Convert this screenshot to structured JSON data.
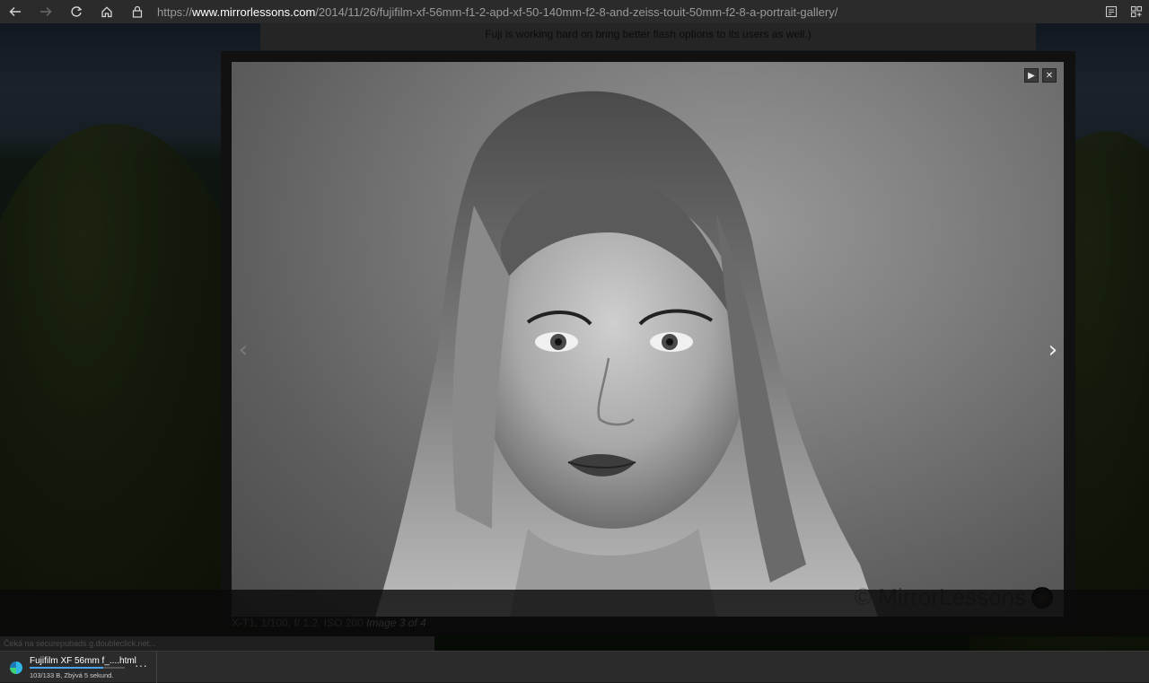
{
  "browser": {
    "url_prefix": "https://",
    "url_host": "www.mirrorlessons.com",
    "url_path": "/2014/11/26/fujifilm-xf-56mm-f1-2-apd-xf-50-140mm-f2-8-and-zeiss-touit-50mm-f2-8-a-portrait-gallery/",
    "icons": [
      "back-icon",
      "forward-icon",
      "refresh-icon",
      "home-icon",
      "lock-icon",
      "reading-view-icon",
      "collections-icon"
    ]
  },
  "page": {
    "text_snippet": "Fuji is working hard on bring better flash options to its users as well.)"
  },
  "lightbox": {
    "caption": "X-T1, 1/100, f/ 1.2, ISO 200",
    "counter": "Image 3 of 4",
    "watermark": "© MirrorLessons",
    "play_symbol": "▶",
    "close_symbol": "✕",
    "prev_symbol": "‹",
    "next_symbol": "›"
  },
  "status": {
    "message": "Čeká na securepubads.g.doubleclick.net..."
  },
  "downloads": {
    "file_name": "Fujifilm XF 56mm f_....html",
    "status": "103/133 B, Zbývá 5 sekund.",
    "progress": 0.77,
    "more_label": "···"
  }
}
